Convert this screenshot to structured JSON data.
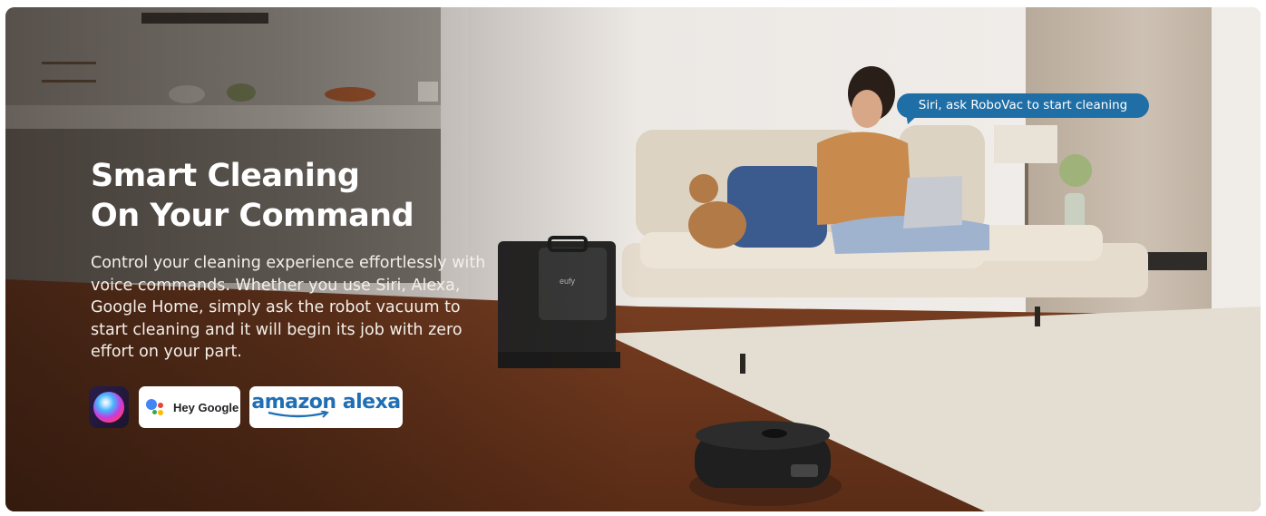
{
  "hero": {
    "headline_line1": "Smart Cleaning",
    "headline_line2": "On Your Command",
    "description": "Control your cleaning experience effortlessly with voice commands. Whether you use Siri, Alexa, Google Home, simply ask the robot vacuum to start cleaning and it will begin its job with zero effort on your part."
  },
  "speech_bubble": {
    "text": "Siri, ask RoboVac to start cleaning",
    "color": "#1f6ea6"
  },
  "voice_badges": [
    {
      "name": "siri",
      "icon": "siri-icon",
      "label": ""
    },
    {
      "name": "google",
      "icon": "google-assistant-icon",
      "label": "Hey Google"
    },
    {
      "name": "alexa",
      "icon": "amazon-alexa-logo",
      "label": "amazon alexa"
    }
  ],
  "dock_label": "eufy",
  "colors": {
    "text": "#ffffff",
    "alexa_blue": "#1f6fb5",
    "google_blue": "#4285f4",
    "google_red": "#ea4335",
    "google_yellow": "#fbbc05",
    "google_green": "#34a853"
  }
}
